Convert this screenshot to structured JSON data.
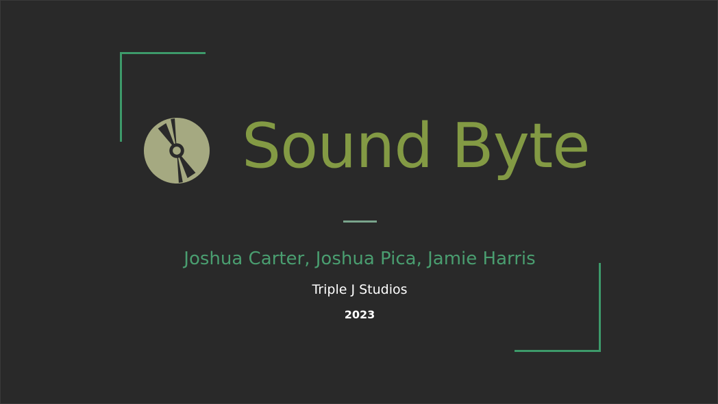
{
  "slide": {
    "title": "Sound Byte",
    "authors": "Joshua Carter, Joshua Pica, Jamie Harris",
    "studio": "Triple J Studios",
    "year": "2023",
    "icon": "compact-disc-icon",
    "colors": {
      "background": "#292929",
      "title": "#839a44",
      "authors": "#4a9e70",
      "frame": "#3d9a6a",
      "disc": "#a5a981"
    }
  }
}
